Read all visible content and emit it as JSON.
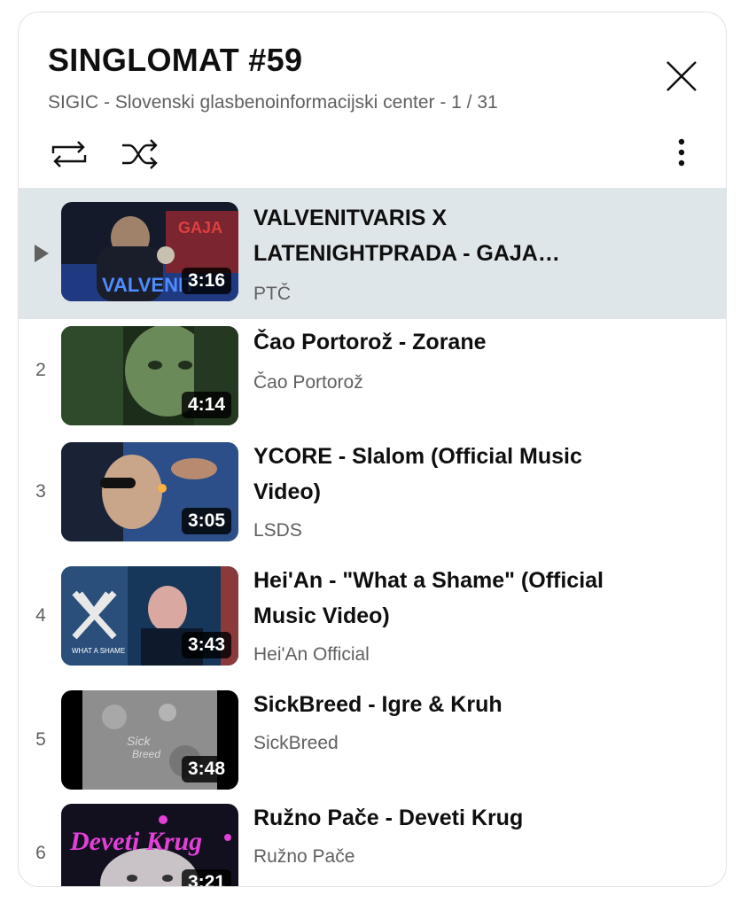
{
  "playlist": {
    "title": "SINGLOMAT #59",
    "subtitle": "SIGIC - Slovenski glasbenoinformacijski center - 1 / 31"
  },
  "controls": {
    "loop_icon": "loop-icon",
    "shuffle_icon": "shuffle-icon",
    "more_icon": "more-vert-icon",
    "close_icon": "close-icon"
  },
  "colors": {
    "active_row": "#dfe6ea",
    "secondary_text": "#606060",
    "duration_bg": "#000000"
  },
  "items": [
    {
      "index": "▶",
      "title": "VALVENITVARIS X LATENIGHTPRADA - GAJA…",
      "channel": "PTČ",
      "duration": "3:16",
      "active": true
    },
    {
      "index": "2",
      "title": "Čao Portorož - Zorane",
      "channel": "Čao Portorož",
      "duration": "4:14"
    },
    {
      "index": "3",
      "title": "YCORE - Slalom (Official Music Video)",
      "channel": "LSDS",
      "duration": "3:05"
    },
    {
      "index": "4",
      "title": "Hei'An - \"What a Shame\" (Official Music Video)",
      "channel": "Hei'An Official",
      "duration": "3:43"
    },
    {
      "index": "5",
      "title": "SickBreed - Igre & Kruh",
      "channel": "SickBreed",
      "duration": "3:48"
    },
    {
      "index": "6",
      "title": "Ružno Pače - Deveti Krug",
      "channel": "Ružno Pače",
      "duration": "3:21"
    }
  ]
}
